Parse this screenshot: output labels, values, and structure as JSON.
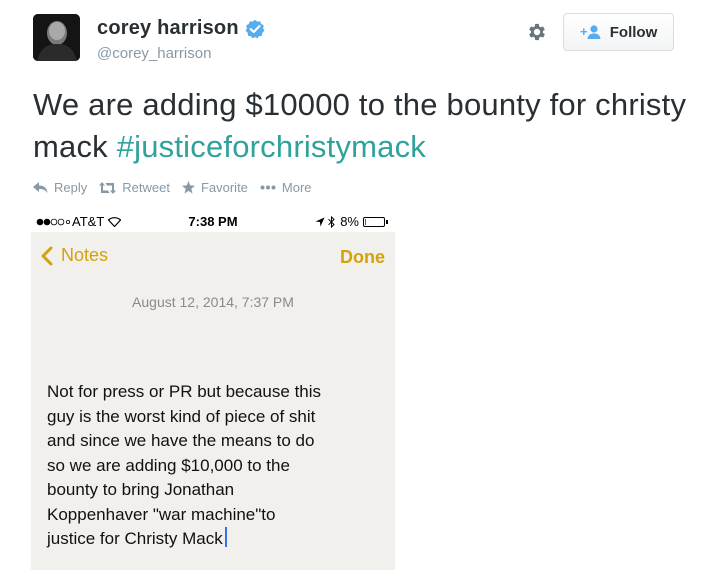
{
  "tweet": {
    "display_name": "corey harrison",
    "screen_name": "@corey_harrison",
    "verified": true,
    "text_main": "We are adding $10000 to the bounty for christy mack ",
    "hashtag": "#justiceforchristymack"
  },
  "header": {
    "follow_label": "Follow",
    "settings_icon": "gear-icon"
  },
  "actions": {
    "reply": "Reply",
    "retweet": "Retweet",
    "favorite": "Favorite",
    "more": "More"
  },
  "screenshot": {
    "status_bar": {
      "carrier": "AT&T",
      "time": "7:38 PM",
      "battery": "8%",
      "battery_level": 0.08
    },
    "nav": {
      "back_label": "Notes",
      "done_label": "Done"
    },
    "note": {
      "date": "August 12, 2014, 7:37 PM",
      "body": "Not for press or PR but because this\nguy is the worst kind of piece of shit\nand since we have the means to do\nso we are adding $10,000 to the\nbounty to bring Jonathan\nKoppenhaver  \"war machine\"to\njustice for Christy Mack"
    }
  },
  "colors": {
    "hashtag": "#2fa39b",
    "notes_accent": "#d4a20c",
    "verified": "#55acee",
    "secondary_text": "#8899a6"
  }
}
